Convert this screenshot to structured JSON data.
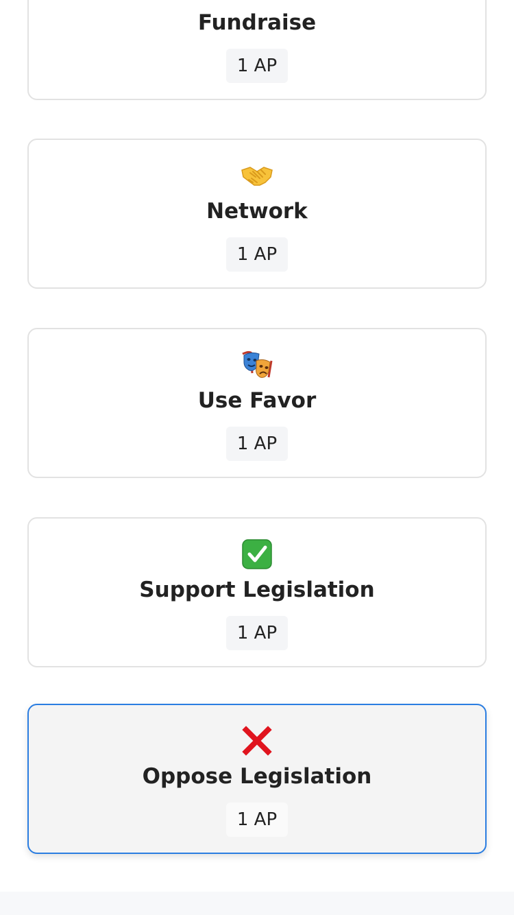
{
  "actions": [
    {
      "icon": "money-bag-icon",
      "title": "Fundraise",
      "cost": "1 AP",
      "selected": false
    },
    {
      "icon": "handshake-icon",
      "title": "Network",
      "cost": "1 AP",
      "selected": false
    },
    {
      "icon": "theater-masks-icon",
      "title": "Use Favor",
      "cost": "1 AP",
      "selected": false
    },
    {
      "icon": "check-mark-icon",
      "title": "Support Legislation",
      "cost": "1 AP",
      "selected": false
    },
    {
      "icon": "cross-mark-icon",
      "title": "Oppose Legislation",
      "cost": "1 AP",
      "selected": true
    }
  ],
  "colors": {
    "selected_border": "#2a7de1",
    "check_green": "#3cb043",
    "cross_red": "#e0141e"
  }
}
